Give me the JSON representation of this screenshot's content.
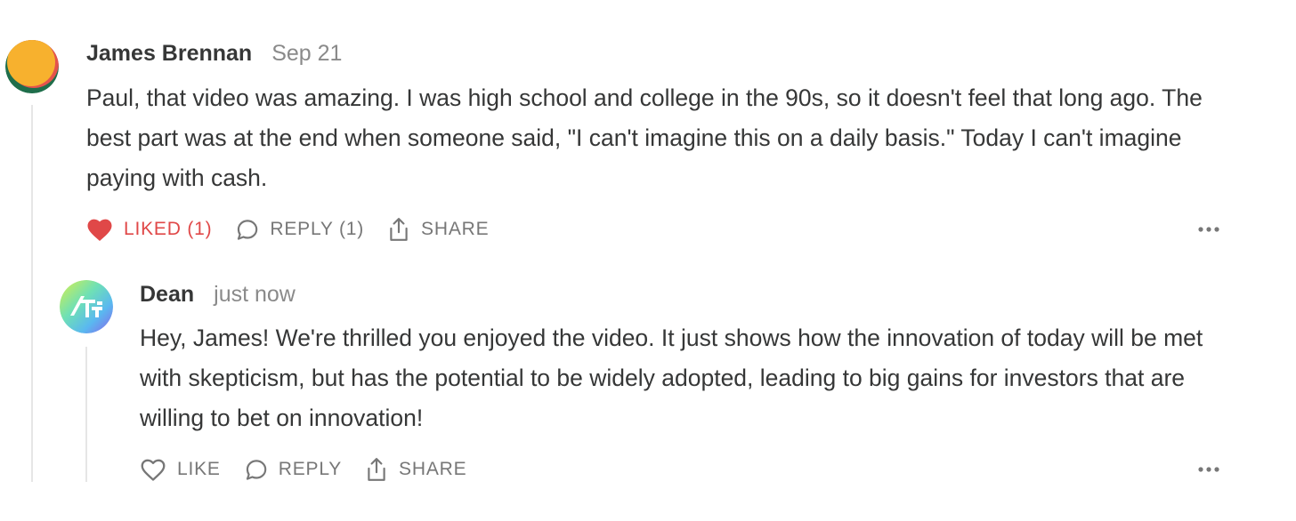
{
  "comments": [
    {
      "author": "James Brennan",
      "date": "Sep 21",
      "avatar_icon": "orange-circle-avatar",
      "body": "Paul, that video was amazing. I was high school and college in the 90s, so it doesn't feel that long ago. The best part was at the end when someone said, \"I can't imagine this on a daily basis.\" Today I can't imagine paying with cash.",
      "actions": {
        "like_label": "LIKED (1)",
        "like_icon": "heart-filled-icon",
        "liked": true,
        "reply_label": "REPLY (1)",
        "reply_icon": "speech-bubble-icon",
        "share_label": "SHARE",
        "share_icon": "share-icon",
        "more_icon": "more-horizontal-icon"
      }
    },
    {
      "author": "Dean",
      "date": "just now",
      "avatar_icon": "gradient-logo-avatar",
      "body": "Hey, James! We're thrilled you enjoyed the video. It just shows how the innovation of today will be met with skepticism, but has the potential to be widely adopted, leading to big gains for investors that are willing to bet on innovation!",
      "actions": {
        "like_label": "LIKE",
        "like_icon": "heart-outline-icon",
        "liked": false,
        "reply_label": "REPLY",
        "reply_icon": "speech-bubble-icon",
        "share_label": "SHARE",
        "share_icon": "share-icon",
        "more_icon": "more-horizontal-icon"
      }
    }
  ],
  "colors": {
    "liked": "#e04848",
    "text": "#363737",
    "muted": "#777777",
    "date": "#8a8a8a",
    "thread_line": "#e6e6e6"
  }
}
